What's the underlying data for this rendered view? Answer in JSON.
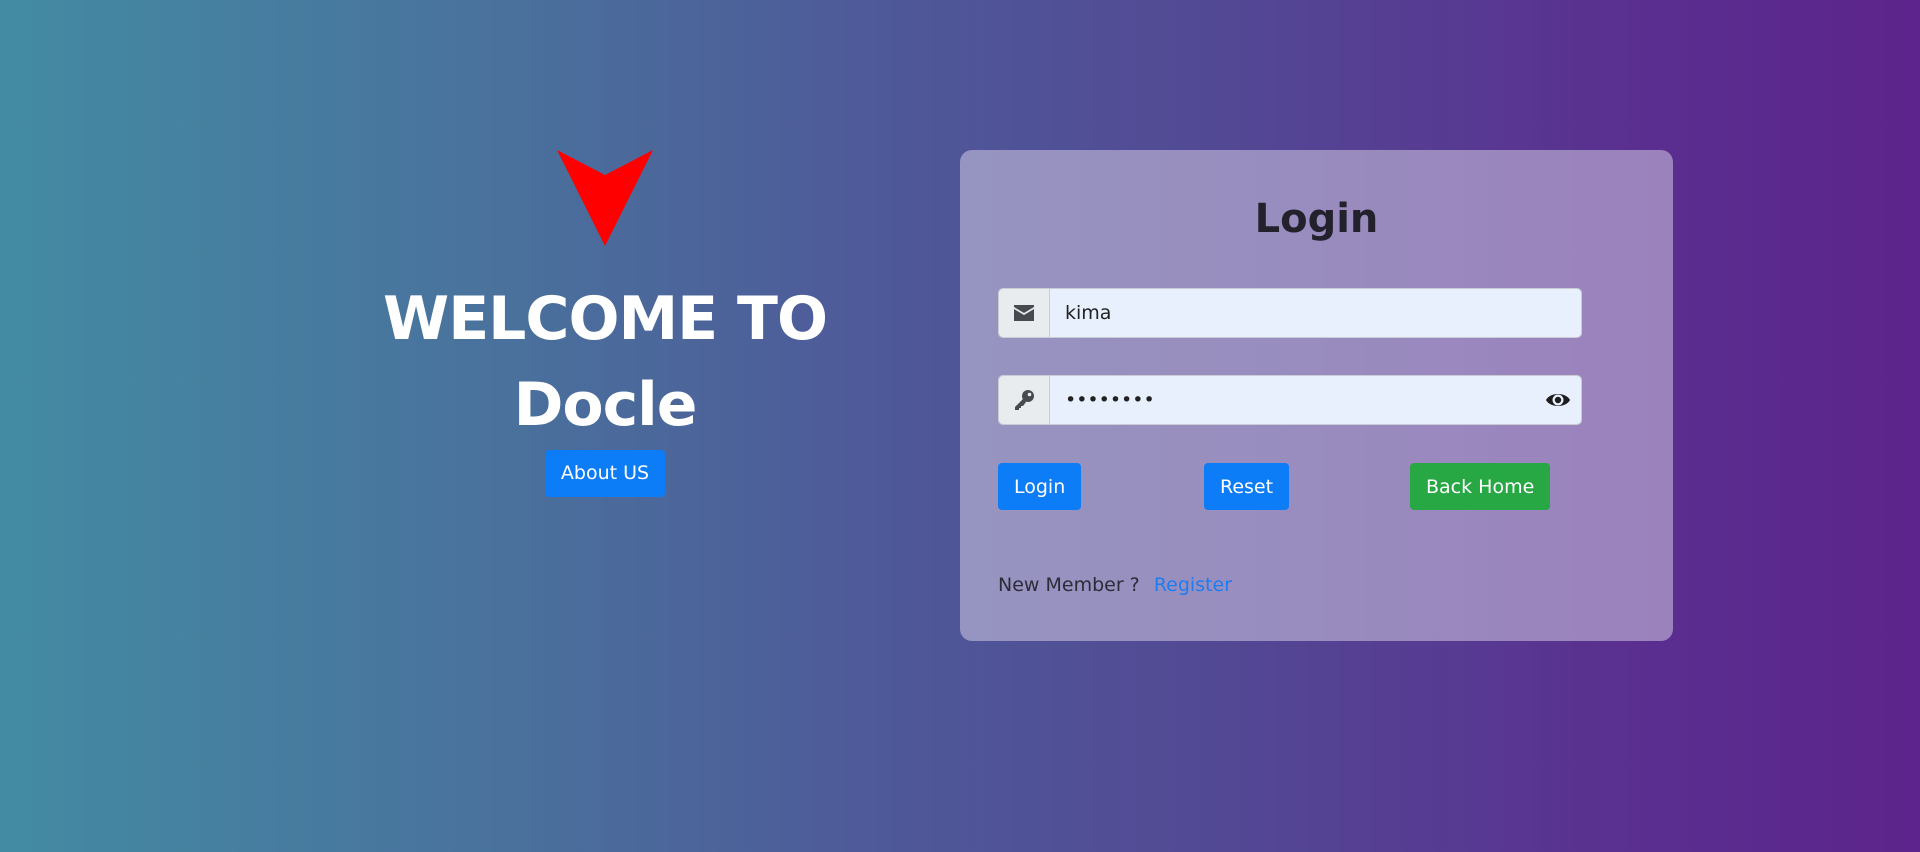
{
  "welcome": {
    "title_line1": "WELCOME TO",
    "title_line2": "Docle",
    "about_label": "About US",
    "logo_icon": "red-arrowhead-logo",
    "logo_color": "#ff0000"
  },
  "login": {
    "title": "Login",
    "email_icon": "envelope-icon",
    "email_value": "kima",
    "password_icon": "key-icon",
    "password_value": "kimakima",
    "show_password_icon": "eye-icon",
    "login_label": "Login",
    "reset_label": "Reset",
    "home_label": "Back Home",
    "new_member_text": "New Member ?",
    "register_label": "Register"
  },
  "colors": {
    "primary": "#0d7cf7",
    "success": "#28a745",
    "link": "#1d7cf2",
    "gradient_start": "#438ba3",
    "gradient_end": "#5c248c"
  }
}
